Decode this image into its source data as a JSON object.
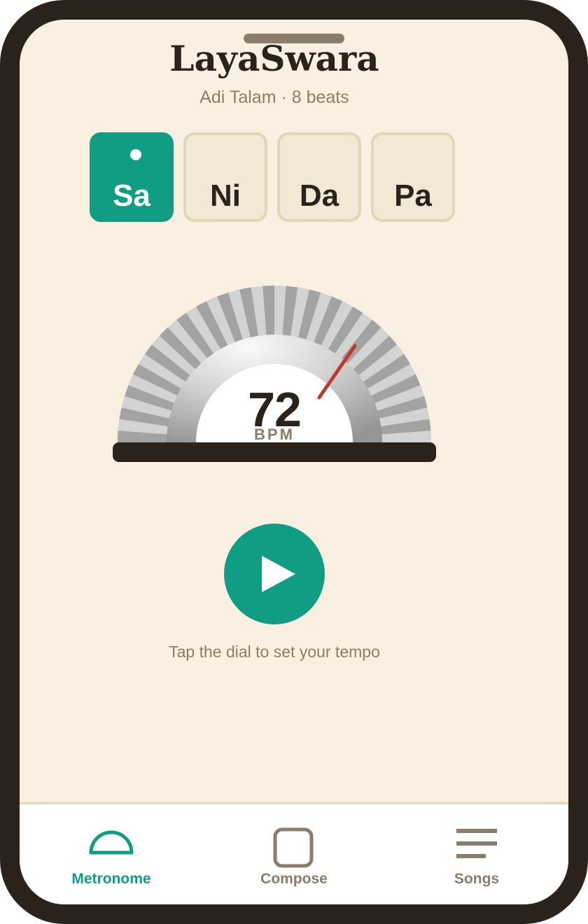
{
  "app": {
    "title": "LayaSwara",
    "subtitle": "Adi Talam · 8 beats"
  },
  "beats": [
    {
      "label": "Sa",
      "active": true
    },
    {
      "label": "Ni",
      "active": false
    },
    {
      "label": "Da",
      "active": false
    },
    {
      "label": "Pa",
      "active": false
    }
  ],
  "tempo": {
    "value": "72",
    "unit": "BPM"
  },
  "controls": {
    "hint": "Tap the dial to set your tempo"
  },
  "tabs": [
    {
      "label": "Metronome",
      "icon": "half-circle-icon",
      "active": true
    },
    {
      "label": "Compose",
      "icon": "square-icon",
      "active": false
    },
    {
      "label": "Songs",
      "icon": "list-icon",
      "active": false
    }
  ],
  "colors": {
    "accent": "#109d84",
    "background": "#f9f0e1",
    "text": "#2b221c",
    "muted": "#8a7d6b",
    "needle": "#c0392b"
  }
}
